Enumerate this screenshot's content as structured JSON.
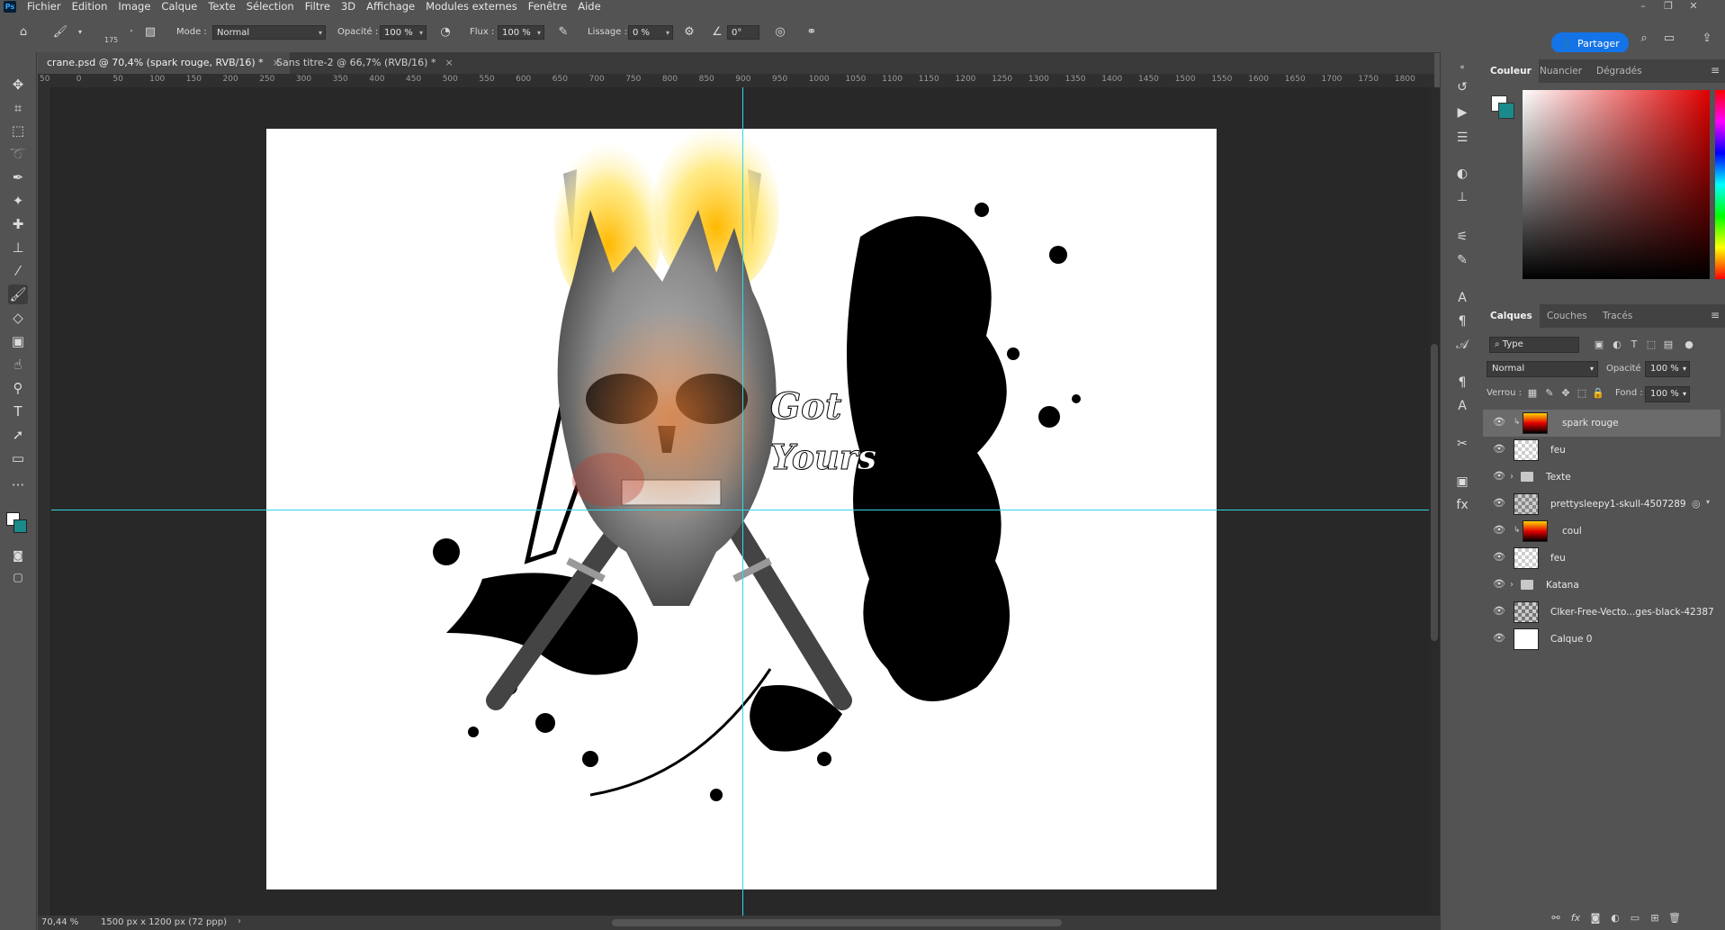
{
  "menubar": {
    "logo": "Ps",
    "items": [
      "Fichier",
      "Edition",
      "Image",
      "Calque",
      "Texte",
      "Sélection",
      "Filtre",
      "3D",
      "Affichage",
      "Modules externes",
      "Fenêtre",
      "Aide"
    ]
  },
  "options": {
    "brush_size": "175",
    "mode_label": "Mode :",
    "mode_value": "Normal",
    "opacity_label": "Opacité :",
    "opacity_value": "100 %",
    "flow_label": "Flux :",
    "flow_value": "100 %",
    "smoothing_label": "Lissage :",
    "smoothing_value": "0 %",
    "angle_value": "0°",
    "share_label": "Partager"
  },
  "tabs": [
    {
      "label": "crane.psd @ 70,4% (spark rouge, RVB/16) *",
      "active": true
    },
    {
      "label": "Sans titre-2 @ 66,7% (RVB/16) *",
      "active": false
    }
  ],
  "ruler_labels": [
    "50",
    "0",
    "50",
    "100",
    "150",
    "200",
    "250",
    "300",
    "350",
    "400",
    "450",
    "500",
    "550",
    "600",
    "650",
    "700",
    "750",
    "800",
    "850",
    "900",
    "950",
    "1000",
    "1050",
    "1100",
    "1150",
    "1200",
    "1250",
    "1300",
    "1350",
    "1400",
    "1450",
    "1500",
    "1550",
    "1600",
    "1650",
    "1700",
    "1750",
    "1800"
  ],
  "artwork": {
    "text_line1": "Got",
    "text_line2": "Yours"
  },
  "status": {
    "zoom": "70,44 %",
    "doc_size": "1500 px x 1200 px (72 ppp)"
  },
  "color_panel": {
    "tabs": [
      "Couleur",
      "Nuancier",
      "Dégradés"
    ],
    "foreground": "#ffffff",
    "background": "#1a8a8a"
  },
  "layers_panel": {
    "tabs": [
      "Calques",
      "Couches",
      "Tracés"
    ],
    "filter_value": "Type",
    "blend_mode": "Normal",
    "opacity_label": "Opacité :",
    "opacity_value": "100 %",
    "lock_label": "Verrou :",
    "fill_label": "Fond :",
    "fill_value": "100 %",
    "layers": [
      {
        "name": "spark rouge",
        "kind": "gradient",
        "selected": true
      },
      {
        "name": "feu",
        "kind": "transparent",
        "selected": false
      },
      {
        "name": "Texte",
        "kind": "group",
        "selected": false
      },
      {
        "name": "prettysleepy1-skull-4507289",
        "kind": "image",
        "selected": false
      },
      {
        "name": "coul",
        "kind": "gradient",
        "selected": false
      },
      {
        "name": "feu",
        "kind": "transparent",
        "selected": false
      },
      {
        "name": "Katana",
        "kind": "group",
        "selected": false
      },
      {
        "name": "Clker-Free-Vecto...ges-black-42387",
        "kind": "image",
        "selected": false
      },
      {
        "name": "Calque 0",
        "kind": "white",
        "selected": false
      }
    ]
  }
}
